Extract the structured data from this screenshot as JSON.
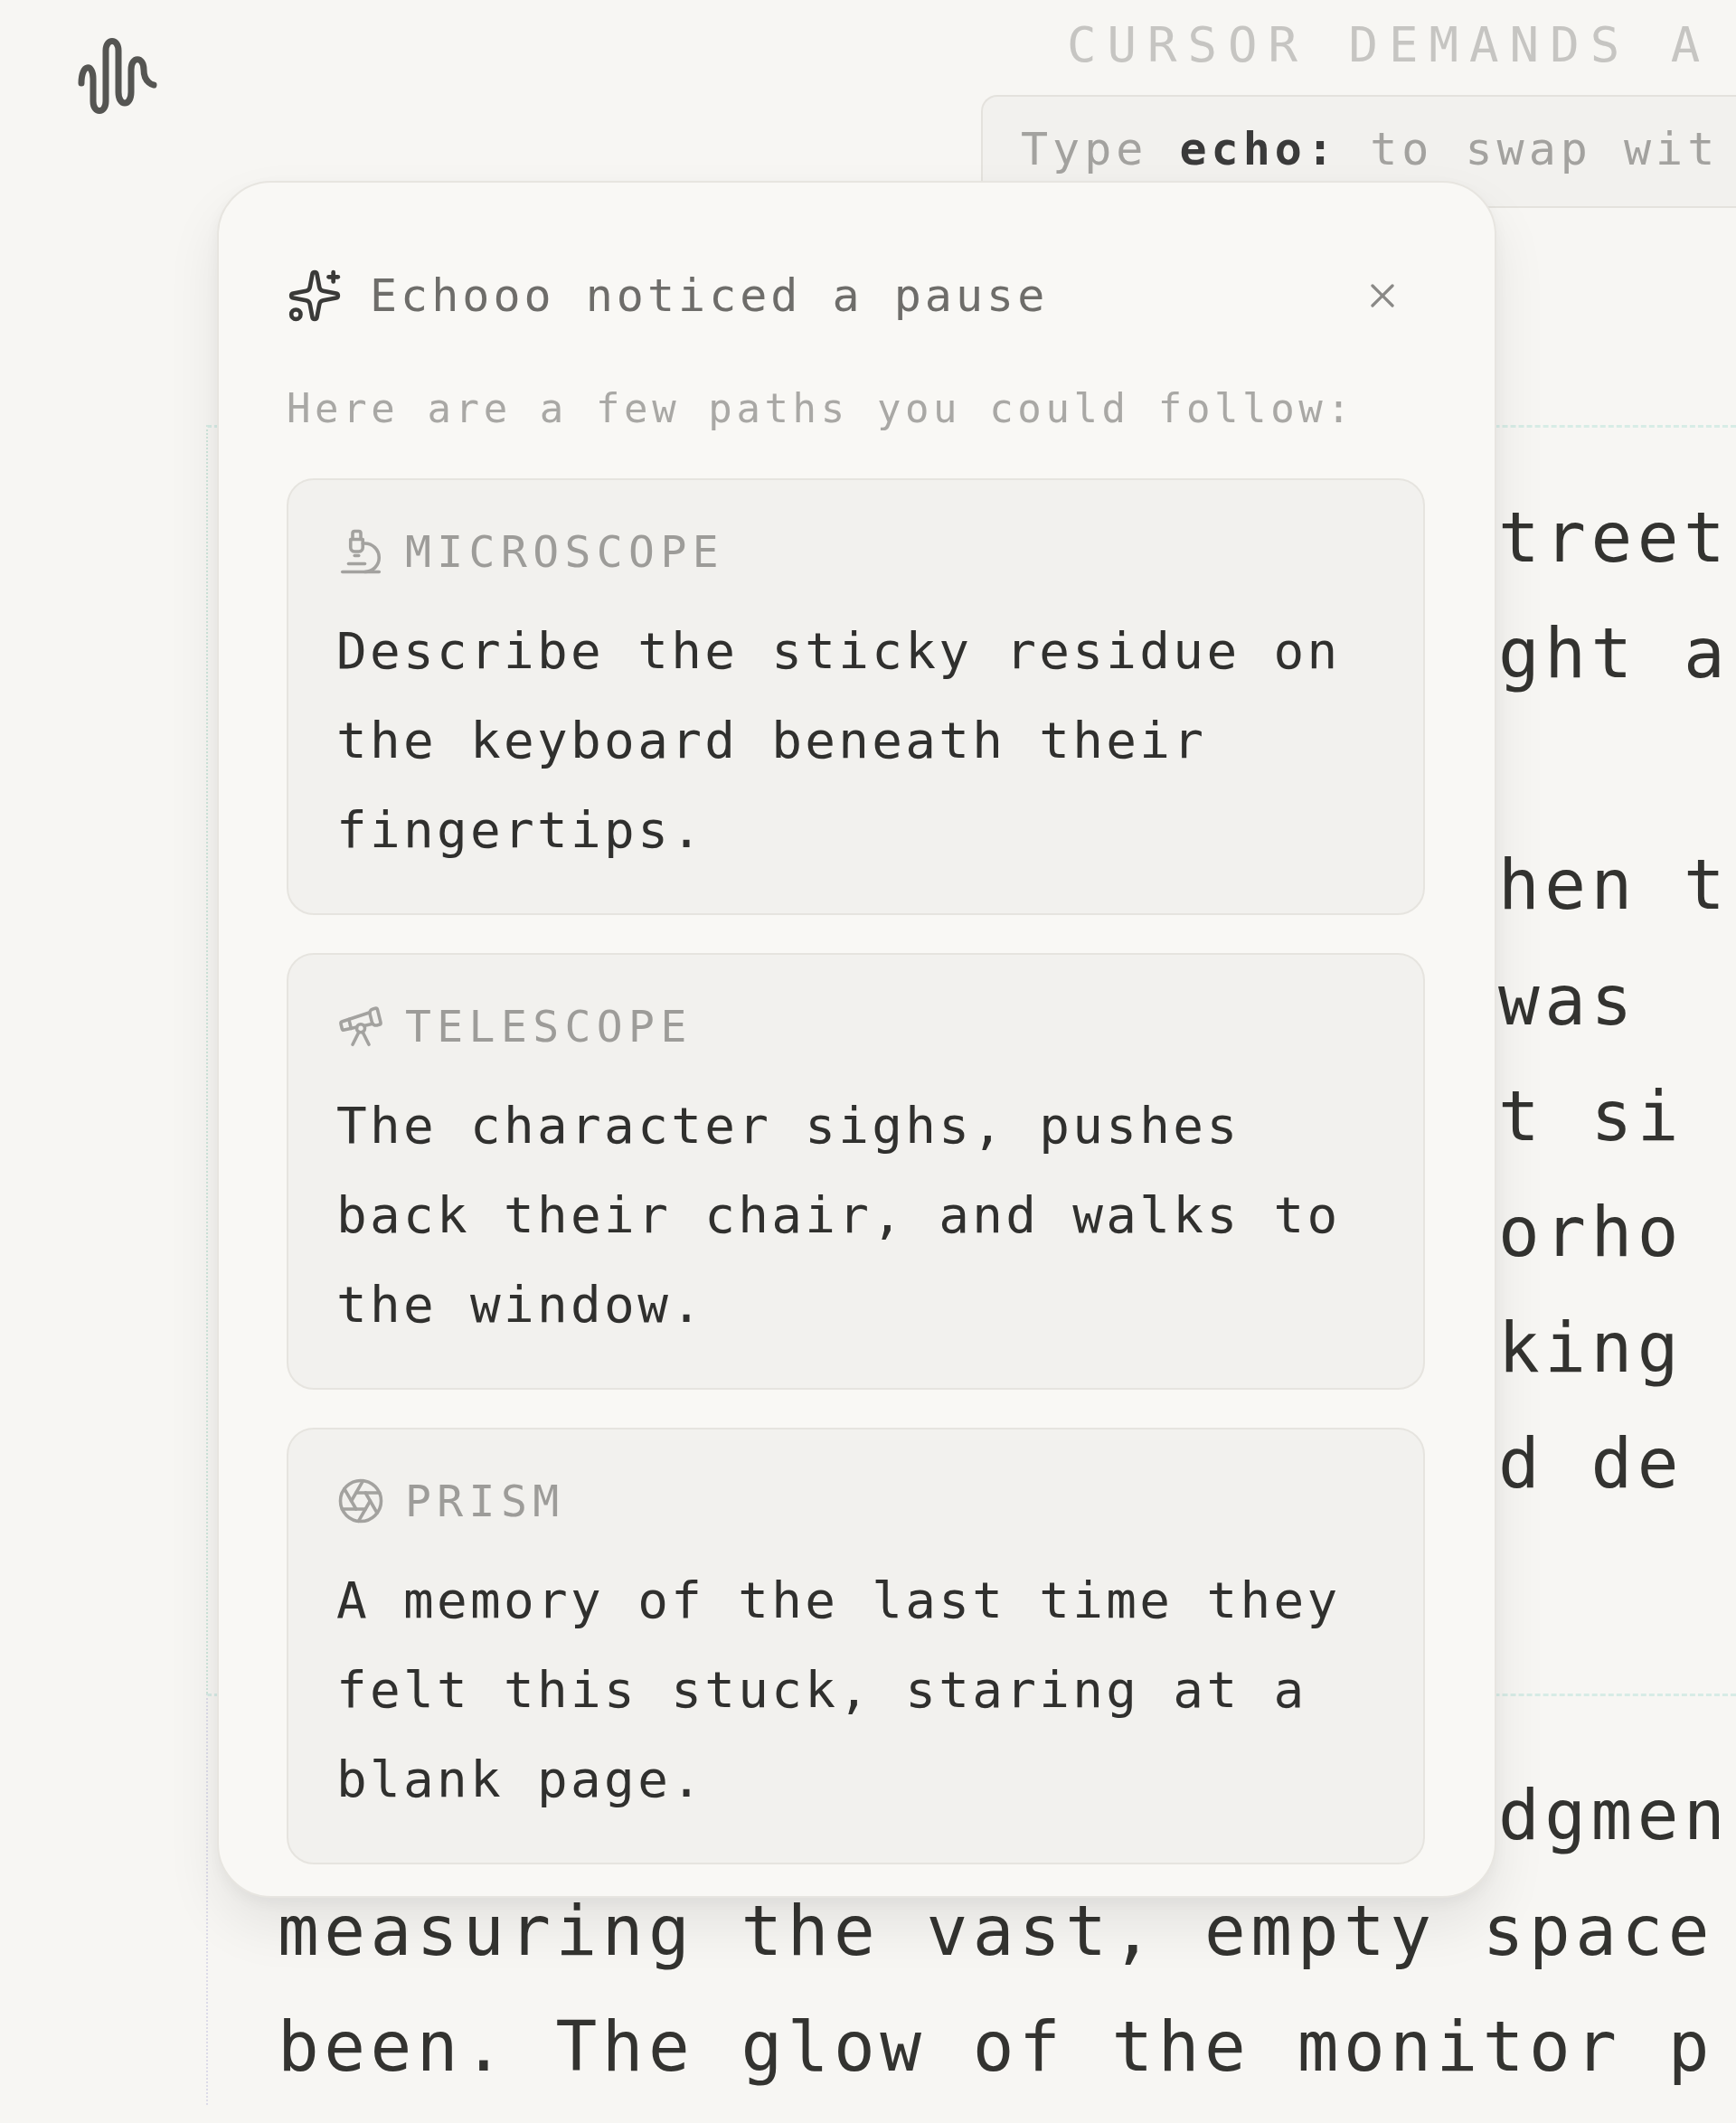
{
  "header": {
    "title": "CURSOR DEMANDS A",
    "input_hint": "Type **echo:** to swap wit"
  },
  "editor": {
    "sections": [
      {
        "paragraphs": [
          [
            {
              "text": "treet",
              "kind": "fragment"
            },
            {
              "text": "ght a",
              "kind": "fragment"
            }
          ],
          [
            {
              "text": "hen t",
              "kind": "fragment"
            },
            {
              "text": "was",
              "kind": "fragment"
            },
            {
              "text": "t si",
              "kind": "fragment"
            },
            {
              "text": "orho",
              "kind": "fragment"
            },
            {
              "text": "king",
              "kind": "fragment"
            },
            {
              "text": "d de",
              "kind": "fragment"
            }
          ]
        ]
      },
      {
        "paragraphs": [
          [
            {
              "text": "dgmen",
              "kind": "fragment"
            },
            {
              "text": "measuring the vast, empty space",
              "kind": "full"
            },
            {
              "text": "been. The glow of the monitor p",
              "kind": "full"
            }
          ]
        ]
      }
    ]
  },
  "popover": {
    "title": "Echooo noticed a pause",
    "subtitle": "Here are a few paths you could follow:",
    "suggestions": [
      {
        "kind": "microscope",
        "label": "MICROSCOPE",
        "text": "Describe the sticky residue on the keyboard beneath their fingertips."
      },
      {
        "kind": "telescope",
        "label": "TELESCOPE",
        "text": "The character sighs, pushes back their chair, and walks to the window."
      },
      {
        "kind": "prism",
        "label": "PRISM",
        "text": "A memory of the last time they felt this stuck, staring at a blank page."
      }
    ]
  }
}
